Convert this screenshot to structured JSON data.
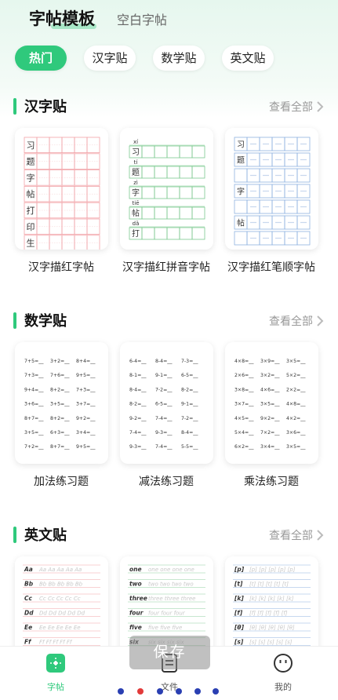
{
  "top_tabs": {
    "active": "字帖模板",
    "other": "空白字帖"
  },
  "chips": [
    "热门",
    "汉字贴",
    "数学贴",
    "英文贴"
  ],
  "sections": {
    "hanzi": {
      "title": "汉字贴",
      "see_all": "查看全部"
    },
    "math": {
      "title": "数学贴",
      "see_all": "查看全部"
    },
    "english": {
      "title": "英文贴",
      "see_all": "查看全部"
    }
  },
  "hanzi_cards": [
    {
      "label": "汉字描红字帖",
      "chars": [
        "习",
        "题",
        "字",
        "帖",
        "打",
        "印",
        "生"
      ]
    },
    {
      "label": "汉字描红拼音字帖",
      "rows": [
        [
          "xí",
          "习"
        ],
        [
          "tí",
          "题"
        ],
        [
          "zì",
          "字"
        ],
        [
          "tiē",
          "帖"
        ],
        [
          "dǎ",
          "打"
        ]
      ]
    },
    {
      "label": "汉字描红笔顺字帖",
      "chars": [
        "习",
        "题",
        "",
        "字",
        "",
        "帖",
        ""
      ]
    }
  ],
  "math_cards": [
    {
      "label": "加法练习题",
      "rows": [
        [
          "7+5=__",
          "3+2=__",
          "8+4=__"
        ],
        [
          "7+3=__",
          "7+6=__",
          "9+5=__"
        ],
        [
          "9+4=__",
          "8+2=__",
          "7+3=__"
        ],
        [
          "3+6=__",
          "3+5=__",
          "3+7=__"
        ],
        [
          "8+7=__",
          "8+2=__",
          "9+2=__"
        ],
        [
          "3+5=__",
          "6+3=__",
          "3+4=__"
        ],
        [
          "7+2=__",
          "8+7=__",
          "9+5=__"
        ]
      ]
    },
    {
      "label": "减法练习题",
      "rows": [
        [
          "6-4=__",
          "8-4=__",
          "7-3=__"
        ],
        [
          "8-1=__",
          "9-1=__",
          "6-5=__"
        ],
        [
          "8-4=__",
          "7-2=__",
          "8-2=__"
        ],
        [
          "8-2=__",
          "6-5=__",
          "9-1=__"
        ],
        [
          "9-2=__",
          "7-4=__",
          "7-2=__"
        ],
        [
          "7-4=__",
          "9-3=__",
          "8-4=__"
        ],
        [
          "9-3=__",
          "7-4=__",
          "5-5=__"
        ]
      ]
    },
    {
      "label": "乘法练习题",
      "rows": [
        [
          "4×8=__",
          "3×9=__",
          "3×5=__"
        ],
        [
          "2×6=__",
          "3×2=__",
          "5×2=__"
        ],
        [
          "3×8=__",
          "4×6=__",
          "2×2=__"
        ],
        [
          "3×7=__",
          "3×5=__",
          "4×8=__"
        ],
        [
          "4×5=__",
          "9×2=__",
          "4×2=__"
        ],
        [
          "5×4=__",
          "7×2=__",
          "3×6=__"
        ],
        [
          "6×2=__",
          "3×4=__",
          "3×5=__"
        ]
      ]
    }
  ],
  "english_cards": [
    {
      "rows": [
        [
          "Aa",
          "Aa Aa Aa Aa Aa"
        ],
        [
          "Bb",
          "Bb Bb Bb Bb Bb"
        ],
        [
          "Cc",
          "Cc Cc Cc Cc Cc"
        ],
        [
          "Dd",
          "Dd Dd Dd Dd Dd"
        ],
        [
          "Ee",
          "Ee Ee Ee Ee Ee"
        ],
        [
          "Ff",
          "Ff Ff Ff Ff Ff"
        ]
      ]
    },
    {
      "rows": [
        [
          "one",
          "one one one one"
        ],
        [
          "two",
          "two two two two"
        ],
        [
          "three",
          "three three three"
        ],
        [
          "four",
          "four four four"
        ],
        [
          "five",
          "five five five"
        ],
        [
          "six",
          "six six six six"
        ]
      ]
    },
    {
      "rows": [
        [
          "[p]",
          "[p] [p] [p] [p] [p]"
        ],
        [
          "[t]",
          "[t] [t] [t] [t] [t]"
        ],
        [
          "[k]",
          "[k] [k] [k] [k] [k]"
        ],
        [
          "[f]",
          "[f] [f] [f] [f] [f]"
        ],
        [
          "[θ]",
          "[θ] [θ] [θ] [θ] [θ]"
        ],
        [
          "[s]",
          "[s] [s] [s] [s] [s]"
        ]
      ]
    }
  ],
  "save_button": "保存",
  "bottom_nav": [
    {
      "label": "字帖",
      "icon": "template-icon"
    },
    {
      "label": "文件",
      "icon": "file-icon"
    },
    {
      "label": "我的",
      "icon": "profile-icon"
    }
  ],
  "colors": {
    "accent": "#2fc97c",
    "pink_grid": "#f2a3a8",
    "green_grid": "#7cc98f",
    "blue_grid": "#8fb2e0"
  }
}
